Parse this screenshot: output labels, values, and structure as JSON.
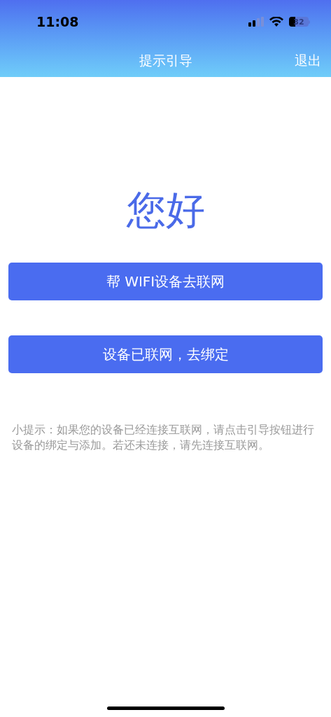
{
  "status_bar": {
    "time": "11:08",
    "battery": "32"
  },
  "nav_bar": {
    "title": "提示引导",
    "exit": "退出"
  },
  "greeting": "您好",
  "buttons": [
    "帮 WIFI设备去联网",
    "设备已联网，去绑定"
  ],
  "tip": "小提示：如果您的设备已经连接互联网，请点击引导按钮进行设备的绑定与添加。若还未连接，请先连接互联网。"
}
